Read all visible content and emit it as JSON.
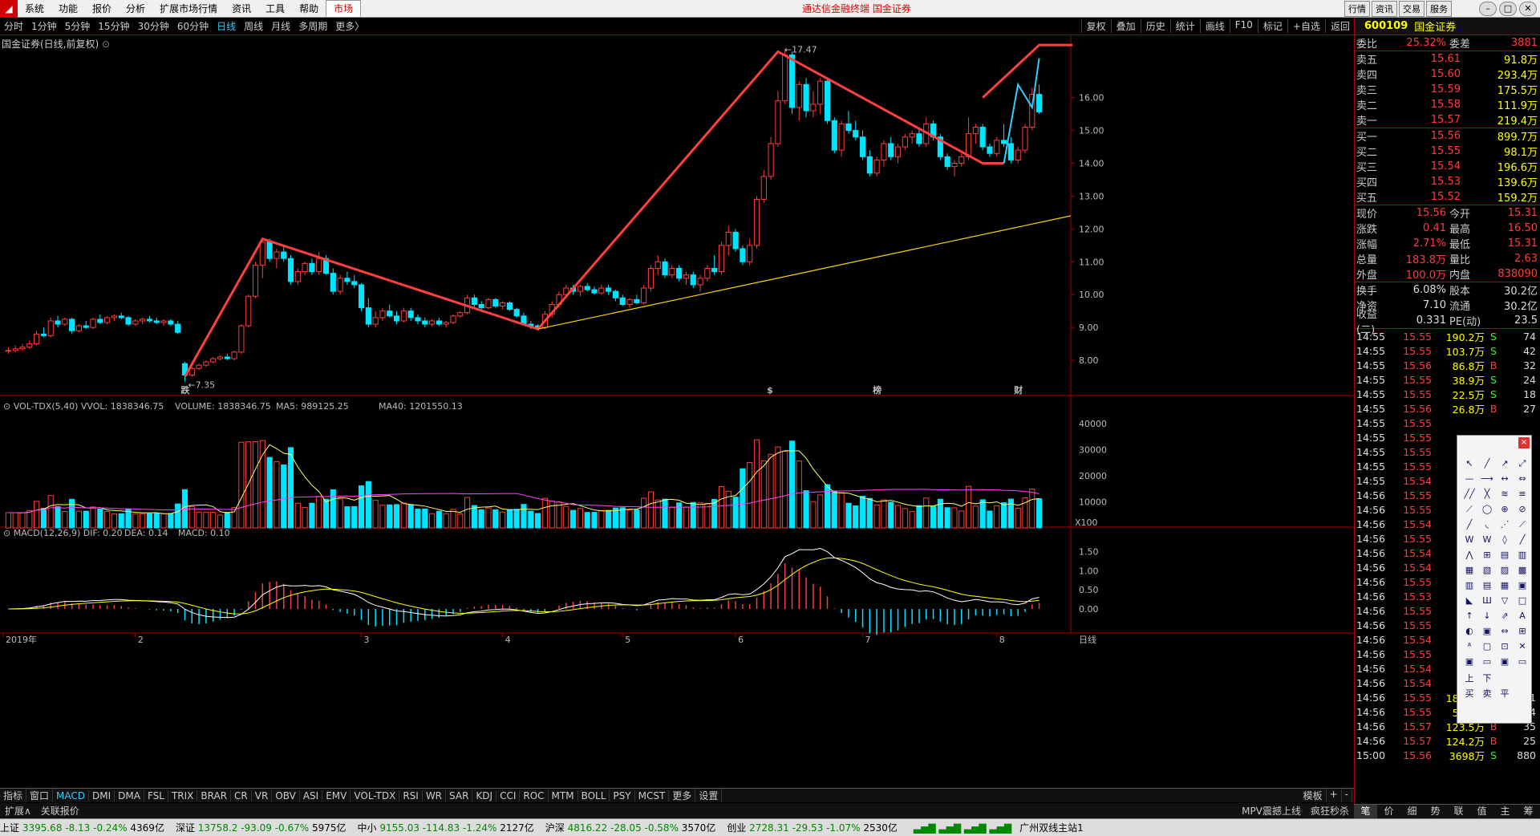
{
  "menubar": {
    "items": [
      "系统",
      "功能",
      "报价",
      "分析",
      "扩展市场行情",
      "资讯",
      "工具",
      "帮助"
    ],
    "active": "市场",
    "center": "通达信金融终端 国金证券",
    "right_buttons": [
      "行情",
      "资讯",
      "交易",
      "服务"
    ]
  },
  "periods": [
    "分时",
    "1分钟",
    "5分钟",
    "15分钟",
    "30分钟",
    "60分钟",
    "日线",
    "周线",
    "月线",
    "多周期",
    "更多"
  ],
  "selected_period": "日线",
  "toolbar": [
    "复权",
    "叠加",
    "历史",
    "统计",
    "画线",
    "F10",
    "标记",
    "+自选",
    "返回"
  ],
  "chart_title": "国金证券(日线,前复权)",
  "vol_label": {
    "name": "VOL-TDX(5,40)",
    "vvol": "VVOL: 1838346.75",
    "volume": "VOLUME: 1838346.75",
    "ma5": "MA5: 989125.25",
    "ma40": "MA40: 1201550.13"
  },
  "macd_label": {
    "name": "MACD(12,26,9)",
    "dif": "DIF: 0.20",
    "dea": "DEA: 0.14",
    "macd": "MACD: 0.10"
  },
  "chart_data": {
    "type": "candlestick",
    "price_axis": [
      "16.00",
      "15.00",
      "14.00",
      "13.00",
      "12.00",
      "11.00",
      "10.00",
      "9.00",
      "8.00"
    ],
    "price_range": [
      7.0,
      17.8
    ],
    "high_label": "17.47",
    "low_label": "7.35",
    "vol_axis": [
      "40000",
      "30000",
      "20000",
      "10000"
    ],
    "vol_unit": "X100",
    "macd_axis": [
      "1.50",
      "1.00",
      "0.50",
      "0.00"
    ],
    "date_labels": [
      "2019年",
      "2",
      "3",
      "4",
      "5",
      "6",
      "7",
      "8"
    ],
    "markers": [
      {
        "text": "跌",
        "color": "#0f0"
      },
      {
        "text": "$",
        "color": "#f44"
      },
      {
        "text": "榜",
        "color": "#fa0"
      },
      {
        "text": "财",
        "color": "#4af"
      }
    ],
    "candles": [
      [
        8.3,
        8.4,
        8.2,
        8.3
      ],
      [
        8.3,
        8.45,
        8.25,
        8.35
      ],
      [
        8.35,
        8.5,
        8.3,
        8.4
      ],
      [
        8.4,
        8.6,
        8.35,
        8.5
      ],
      [
        8.5,
        8.9,
        8.45,
        8.8
      ],
      [
        8.8,
        9.0,
        8.7,
        8.75
      ],
      [
        8.75,
        9.3,
        8.7,
        9.2
      ],
      [
        9.2,
        9.35,
        9.0,
        9.1
      ],
      [
        9.1,
        9.3,
        9.05,
        9.25
      ],
      [
        9.25,
        9.3,
        8.8,
        8.9
      ],
      [
        8.9,
        9.1,
        8.85,
        9.05
      ],
      [
        9.05,
        9.2,
        8.95,
        9.0
      ],
      [
        9.0,
        9.3,
        8.95,
        9.25
      ],
      [
        9.25,
        9.4,
        9.1,
        9.15
      ],
      [
        9.15,
        9.35,
        9.1,
        9.3
      ],
      [
        9.3,
        9.4,
        9.2,
        9.35
      ],
      [
        9.35,
        9.45,
        9.25,
        9.3
      ],
      [
        9.3,
        9.35,
        9.05,
        9.1
      ],
      [
        9.1,
        9.25,
        9.05,
        9.2
      ],
      [
        9.2,
        9.3,
        9.1,
        9.25
      ],
      [
        9.25,
        9.35,
        9.15,
        9.2
      ],
      [
        9.2,
        9.3,
        9.1,
        9.15
      ],
      [
        9.15,
        9.25,
        9.05,
        9.2
      ],
      [
        9.2,
        9.25,
        9.05,
        9.1
      ],
      [
        9.1,
        9.2,
        8.8,
        8.85
      ],
      [
        7.9,
        7.95,
        7.35,
        7.55
      ],
      [
        7.55,
        7.8,
        7.5,
        7.75
      ],
      [
        7.75,
        7.9,
        7.7,
        7.85
      ],
      [
        7.85,
        8.0,
        7.8,
        7.95
      ],
      [
        7.95,
        8.1,
        7.9,
        8.05
      ],
      [
        8.05,
        8.15,
        8.0,
        8.1
      ],
      [
        8.1,
        8.2,
        8.0,
        8.05
      ],
      [
        8.05,
        8.3,
        8.0,
        8.25
      ],
      [
        8.25,
        9.1,
        8.2,
        9.05
      ],
      [
        9.05,
        10.0,
        9.0,
        9.95
      ],
      [
        9.95,
        11.0,
        9.9,
        10.9
      ],
      [
        10.9,
        11.7,
        10.5,
        11.6
      ],
      [
        11.6,
        11.7,
        11.0,
        11.1
      ],
      [
        11.1,
        11.4,
        10.8,
        11.3
      ],
      [
        11.3,
        11.5,
        11.0,
        11.1
      ],
      [
        11.1,
        11.2,
        10.3,
        10.4
      ],
      [
        10.4,
        10.8,
        10.3,
        10.7
      ],
      [
        10.7,
        11.0,
        10.6,
        10.95
      ],
      [
        10.95,
        11.1,
        10.6,
        10.7
      ],
      [
        10.7,
        11.3,
        10.6,
        11.1
      ],
      [
        11.1,
        11.2,
        10.6,
        10.65
      ],
      [
        10.65,
        10.8,
        10.0,
        10.1
      ],
      [
        10.1,
        10.6,
        10.0,
        10.5
      ],
      [
        10.5,
        10.7,
        10.3,
        10.4
      ],
      [
        10.4,
        10.6,
        10.2,
        10.3
      ],
      [
        10.3,
        10.35,
        9.5,
        9.6
      ],
      [
        9.6,
        9.9,
        9.0,
        9.1
      ],
      [
        9.1,
        9.5,
        9.0,
        9.3
      ],
      [
        9.3,
        9.6,
        9.2,
        9.5
      ],
      [
        9.5,
        9.7,
        9.3,
        9.35
      ],
      [
        9.35,
        9.5,
        9.1,
        9.2
      ],
      [
        9.2,
        9.6,
        9.15,
        9.5
      ],
      [
        9.5,
        9.6,
        9.2,
        9.3
      ],
      [
        9.3,
        9.4,
        9.1,
        9.2
      ],
      [
        9.2,
        9.3,
        9.0,
        9.1
      ],
      [
        9.1,
        9.25,
        9.05,
        9.2
      ],
      [
        9.2,
        9.3,
        9.05,
        9.1
      ],
      [
        9.1,
        9.2,
        9.0,
        9.15
      ],
      [
        9.15,
        9.4,
        9.1,
        9.35
      ],
      [
        9.35,
        9.5,
        9.3,
        9.45
      ],
      [
        9.45,
        10.0,
        9.4,
        9.9
      ],
      [
        9.9,
        10.0,
        9.6,
        9.7
      ],
      [
        9.7,
        9.8,
        9.5,
        9.6
      ],
      [
        9.6,
        9.9,
        9.55,
        9.85
      ],
      [
        9.85,
        9.9,
        9.6,
        9.65
      ],
      [
        9.65,
        9.8,
        9.55,
        9.75
      ],
      [
        9.75,
        9.8,
        9.5,
        9.55
      ],
      [
        9.55,
        9.6,
        9.3,
        9.35
      ],
      [
        9.35,
        9.45,
        9.05,
        9.1
      ],
      [
        9.1,
        9.2,
        8.95,
        9.05
      ],
      [
        9.05,
        9.1,
        8.9,
        9.0
      ],
      [
        9.0,
        9.5,
        8.95,
        9.4
      ],
      [
        9.4,
        9.8,
        9.3,
        9.7
      ],
      [
        9.7,
        10.1,
        9.6,
        10.0
      ],
      [
        10.0,
        10.3,
        9.9,
        10.2
      ],
      [
        10.2,
        10.3,
        10.0,
        10.1
      ],
      [
        10.1,
        10.3,
        9.95,
        10.25
      ],
      [
        10.25,
        10.35,
        10.1,
        10.15
      ],
      [
        10.15,
        10.25,
        10.0,
        10.05
      ],
      [
        10.05,
        10.3,
        10.0,
        10.2
      ],
      [
        10.2,
        10.3,
        10.0,
        10.1
      ],
      [
        10.1,
        10.15,
        9.8,
        9.9
      ],
      [
        9.9,
        10.0,
        9.65,
        9.7
      ],
      [
        9.7,
        9.9,
        9.6,
        9.85
      ],
      [
        9.85,
        10.0,
        9.7,
        9.75
      ],
      [
        9.75,
        10.3,
        9.7,
        10.2
      ],
      [
        10.2,
        10.9,
        10.1,
        10.8
      ],
      [
        10.8,
        11.2,
        10.6,
        11.0
      ],
      [
        11.0,
        11.1,
        10.5,
        10.6
      ],
      [
        10.6,
        10.9,
        10.5,
        10.8
      ],
      [
        10.8,
        10.9,
        10.4,
        10.5
      ],
      [
        10.5,
        10.7,
        10.3,
        10.6
      ],
      [
        10.6,
        10.7,
        10.2,
        10.3
      ],
      [
        10.3,
        10.6,
        10.1,
        10.5
      ],
      [
        10.5,
        10.9,
        10.4,
        10.8
      ],
      [
        10.8,
        11.2,
        10.6,
        10.7
      ],
      [
        10.7,
        11.6,
        10.6,
        11.5
      ],
      [
        11.5,
        12.1,
        11.2,
        11.9
      ],
      [
        11.9,
        12.0,
        11.3,
        11.4
      ],
      [
        11.4,
        11.5,
        10.9,
        11.0
      ],
      [
        11.0,
        11.7,
        10.9,
        11.5
      ],
      [
        11.5,
        13.0,
        11.4,
        12.9
      ],
      [
        12.9,
        13.8,
        12.8,
        13.6
      ],
      [
        13.6,
        14.8,
        13.5,
        14.6
      ],
      [
        14.6,
        16.2,
        14.5,
        15.9
      ],
      [
        15.9,
        17.47,
        15.8,
        17.3
      ],
      [
        17.3,
        17.4,
        15.5,
        15.7
      ],
      [
        15.7,
        16.5,
        15.3,
        16.4
      ],
      [
        16.4,
        16.6,
        15.4,
        15.6
      ],
      [
        15.6,
        16.2,
        15.4,
        15.8
      ],
      [
        15.8,
        16.6,
        15.5,
        16.5
      ],
      [
        16.5,
        16.6,
        15.2,
        15.3
      ],
      [
        15.3,
        15.4,
        14.3,
        14.4
      ],
      [
        14.4,
        15.3,
        14.2,
        15.2
      ],
      [
        15.2,
        15.6,
        14.9,
        15.0
      ],
      [
        15.0,
        15.3,
        14.7,
        14.8
      ],
      [
        14.8,
        15.0,
        14.1,
        14.2
      ],
      [
        14.2,
        14.4,
        13.6,
        13.7
      ],
      [
        13.7,
        14.2,
        13.6,
        14.1
      ],
      [
        14.1,
        14.7,
        13.9,
        14.6
      ],
      [
        14.6,
        14.8,
        14.1,
        14.2
      ],
      [
        14.2,
        14.6,
        14.0,
        14.5
      ],
      [
        14.5,
        14.9,
        14.4,
        14.8
      ],
      [
        14.8,
        15.0,
        14.6,
        14.9
      ],
      [
        14.9,
        15.1,
        14.5,
        14.6
      ],
      [
        14.6,
        15.4,
        14.5,
        15.2
      ],
      [
        15.2,
        15.3,
        14.7,
        14.8
      ],
      [
        14.8,
        14.9,
        14.1,
        14.2
      ],
      [
        14.2,
        14.3,
        13.8,
        13.9
      ],
      [
        13.9,
        14.1,
        13.6,
        14.0
      ],
      [
        14.0,
        14.3,
        13.9,
        14.2
      ],
      [
        14.2,
        15.4,
        14.1,
        14.9
      ],
      [
        14.9,
        15.2,
        14.6,
        15.1
      ],
      [
        15.1,
        15.2,
        14.4,
        14.5
      ],
      [
        14.5,
        14.6,
        14.2,
        14.3
      ],
      [
        14.3,
        14.8,
        14.2,
        14.7
      ],
      [
        14.7,
        15.2,
        14.5,
        14.6
      ],
      [
        14.6,
        14.8,
        14.0,
        14.1
      ],
      [
        14.1,
        14.5,
        14.0,
        14.4
      ],
      [
        14.4,
        15.2,
        14.3,
        15.1
      ],
      [
        15.1,
        16.3,
        15.0,
        16.1
      ],
      [
        16.1,
        16.4,
        15.5,
        15.56
      ]
    ]
  },
  "quote": {
    "code": "600109",
    "name": "国金证券",
    "weibi": [
      "委比",
      "25.32%",
      "委差",
      "3881"
    ],
    "sell": [
      [
        "卖五",
        "15.61",
        "91.8万"
      ],
      [
        "卖四",
        "15.60",
        "293.4万"
      ],
      [
        "卖三",
        "15.59",
        "175.5万"
      ],
      [
        "卖二",
        "15.58",
        "111.9万"
      ],
      [
        "卖一",
        "15.57",
        "219.4万"
      ]
    ],
    "buy": [
      [
        "买一",
        "15.56",
        "899.7万"
      ],
      [
        "买二",
        "15.55",
        "98.1万"
      ],
      [
        "买三",
        "15.54",
        "196.6万"
      ],
      [
        "买四",
        "15.53",
        "139.6万"
      ],
      [
        "买五",
        "15.52",
        "159.2万"
      ]
    ],
    "stats": [
      [
        "现价",
        "15.56",
        "今开",
        "15.31"
      ],
      [
        "涨跌",
        "0.41",
        "最高",
        "16.50"
      ],
      [
        "涨幅",
        "2.71%",
        "最低",
        "15.31"
      ],
      [
        "总量",
        "183.8万",
        "量比",
        "2.63"
      ],
      [
        "外盘",
        "100.0万",
        "内盘",
        "838090"
      ]
    ],
    "stats2": [
      [
        "换手",
        "6.08%",
        "股本",
        "30.2亿"
      ],
      [
        "净资",
        "7.10",
        "流通",
        "30.2亿"
      ],
      [
        "收益(二)",
        "0.331",
        "PE(动)",
        "23.5"
      ]
    ],
    "ticks": [
      [
        "14:55",
        "15.55",
        "190.2万",
        "S",
        "74"
      ],
      [
        "14:55",
        "15.55",
        "103.7万",
        "S",
        "42"
      ],
      [
        "14:55",
        "15.56",
        "86.8万",
        "B",
        "32"
      ],
      [
        "14:55",
        "15.55",
        "38.9万",
        "S",
        "24"
      ],
      [
        "14:55",
        "15.55",
        "22.5万",
        "S",
        "18"
      ],
      [
        "14:55",
        "15.56",
        "26.8万",
        "B",
        "27"
      ],
      [
        "14:55",
        "15.55",
        "",
        "",
        ""
      ],
      [
        "14:55",
        "15.55",
        "",
        "",
        ""
      ],
      [
        "14:55",
        "15.55",
        "",
        "",
        ""
      ],
      [
        "14:55",
        "15.55",
        "",
        "",
        ""
      ],
      [
        "14:55",
        "15.54",
        "",
        "",
        ""
      ],
      [
        "14:56",
        "15.55",
        "",
        "",
        ""
      ],
      [
        "14:56",
        "15.55",
        "",
        "",
        ""
      ],
      [
        "14:56",
        "15.54",
        "",
        "",
        ""
      ],
      [
        "14:56",
        "15.55",
        "",
        "",
        ""
      ],
      [
        "14:56",
        "15.54",
        "",
        "",
        ""
      ],
      [
        "14:56",
        "15.54",
        "",
        "",
        ""
      ],
      [
        "14:56",
        "15.55",
        "",
        "",
        ""
      ],
      [
        "14:56",
        "15.53",
        "",
        "",
        ""
      ],
      [
        "14:56",
        "15.55",
        "",
        "",
        ""
      ],
      [
        "14:56",
        "15.55",
        "",
        "",
        ""
      ],
      [
        "14:56",
        "15.54",
        "",
        "",
        ""
      ],
      [
        "14:56",
        "15.55",
        "",
        "",
        ""
      ],
      [
        "14:56",
        "15.54",
        "",
        "",
        ""
      ],
      [
        "14:56",
        "15.54",
        "",
        "",
        ""
      ],
      [
        "14:56",
        "15.55",
        "181.6万",
        "S",
        "31"
      ],
      [
        "14:56",
        "15.55",
        "55.4万",
        "S",
        "24"
      ],
      [
        "14:56",
        "15.57",
        "123.5万",
        "B",
        "35"
      ],
      [
        "14:56",
        "15.57",
        "124.2万",
        "B",
        "25"
      ],
      [
        "15:00",
        "15.56",
        "3698万",
        "S",
        "880"
      ]
    ]
  },
  "quote_tabs": [
    "笔",
    "价",
    "细",
    "势",
    "联",
    "值",
    "主",
    "筹"
  ],
  "indicators": [
    "指标",
    "窗口",
    "MACD",
    "DMI",
    "DMA",
    "FSL",
    "TRIX",
    "BRAR",
    "CR",
    "VR",
    "OBV",
    "ASI",
    "EMV",
    "VOL-TDX",
    "RSI",
    "WR",
    "SAR",
    "KDJ",
    "CCI",
    "ROC",
    "MTM",
    "BOLL",
    "PSY",
    "MCST",
    "更多",
    "设置"
  ],
  "ind_right": [
    "模板",
    "+",
    "-"
  ],
  "bottom": {
    "left": [
      "扩展∧",
      "关联报价"
    ],
    "right": [
      "MPV震撼上线",
      "疯狂秒杀"
    ]
  },
  "statusbar": [
    {
      "name": "上证",
      "val": "3395.68",
      "chg": "-8.13",
      "pct": "-0.24%",
      "amt": "4369亿"
    },
    {
      "name": "深证",
      "val": "13758.2",
      "chg": "-93.09",
      "pct": "-0.67%",
      "amt": "5975亿"
    },
    {
      "name": "中小",
      "val": "9155.03",
      "chg": "-114.83",
      "pct": "-1.24%",
      "amt": "2127亿"
    },
    {
      "name": "沪深",
      "val": "4816.22",
      "chg": "-28.05",
      "pct": "-0.58%",
      "amt": "3570亿"
    },
    {
      "name": "创业",
      "val": "2728.31",
      "chg": "-29.53",
      "pct": "-1.07%",
      "amt": "2530亿"
    }
  ],
  "station": "广州双线主站1",
  "colors": {
    "up": "#ff3c3c",
    "down": "#00e5ff",
    "trend": "#ff4040",
    "support": "#ffd700",
    "ma5": "#ffff66",
    "ma40": "#ff44ff"
  }
}
